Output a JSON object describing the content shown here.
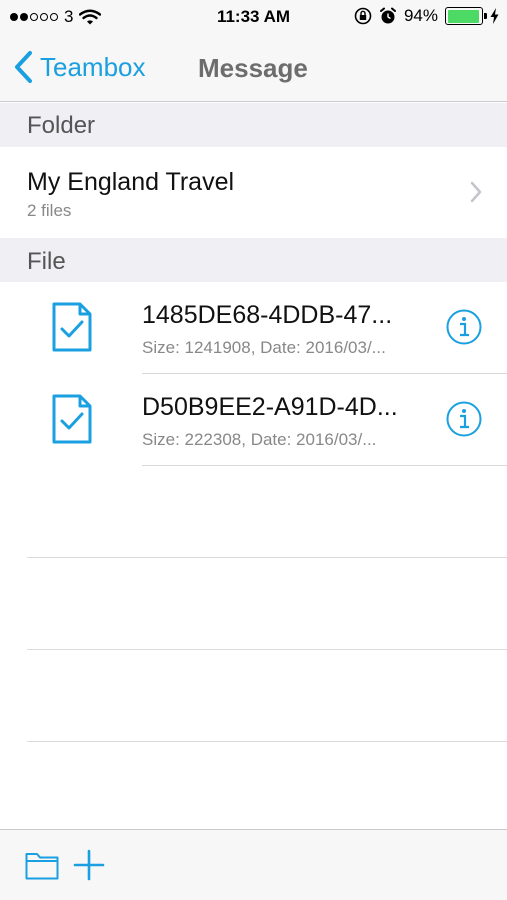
{
  "status_bar": {
    "carrier": "3",
    "time": "11:33 AM",
    "battery_text": "94%",
    "battery_level": 0.94,
    "icons": [
      "signal-dots",
      "wifi-icon",
      "rotation-lock-icon",
      "alarm-icon",
      "battery-icon",
      "charging-bolt-icon"
    ]
  },
  "nav": {
    "back_label": "Teambox",
    "title": "Message"
  },
  "sections": {
    "folder_header": "Folder",
    "file_header": "File"
  },
  "folder": {
    "name": "My England Travel",
    "subtitle": "2 files"
  },
  "files": [
    {
      "name": "1485DE68-4DDB-47...",
      "meta": "Size: 1241908, Date: 2016/03/..."
    },
    {
      "name": "D50B9EE2-A91D-4D...",
      "meta": "Size: 222308, Date: 2016/03/..."
    }
  ],
  "colors": {
    "accent": "#1a9fe0",
    "battery": "#4cd964",
    "section_bg": "#efeff4",
    "bar_bg": "#f7f7f7"
  },
  "toolbar": {
    "icons": [
      "folder-icon",
      "add-icon"
    ]
  }
}
